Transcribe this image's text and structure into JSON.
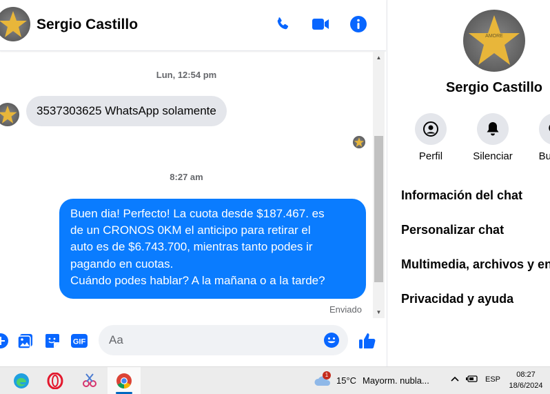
{
  "header": {
    "contact_name": "Sergio Castillo",
    "icons": [
      "phone-icon",
      "video-icon",
      "info-icon"
    ]
  },
  "messages": {
    "timestamp_1": "Lun, 12:54 pm",
    "incoming_text": "3537303625 WhatsApp solamente",
    "timestamp_2": "8:27 am",
    "outgoing_lines": [
      "Buen dia! Perfecto! La cuota desde $187.467. es",
      "de un CRONOS 0KM el anticipo para retirar el",
      "auto es de $6.743.700, mientras tanto podes ir",
      "pagando en cuotas.",
      "Cuándo podes hablar? A la mañana o a la tarde?"
    ],
    "status": "Enviado"
  },
  "composer": {
    "placeholder": "Aa",
    "gif_label": "GIF"
  },
  "panel": {
    "contact_name": "Sergio Castillo",
    "actions": [
      {
        "label": "Perfil",
        "icon": "profile-icon"
      },
      {
        "label": "Silenciar",
        "icon": "bell-icon"
      },
      {
        "label": "Buscar",
        "icon": "search-icon"
      }
    ],
    "menu": [
      "Información del chat",
      "Personalizar chat",
      "Multimedia, archivos y enlaces",
      "Privacidad y ayuda"
    ]
  },
  "taskbar": {
    "weather_temp": "15°C",
    "weather_desc": "Mayorm. nubla...",
    "weather_badge": "1",
    "language": "ESP",
    "time": "08:27",
    "date": "18/6/2024"
  },
  "colors": {
    "accent": "#0a7cff",
    "icon_blue": "#0866ff",
    "incoming_bubble": "#e4e6eb"
  }
}
